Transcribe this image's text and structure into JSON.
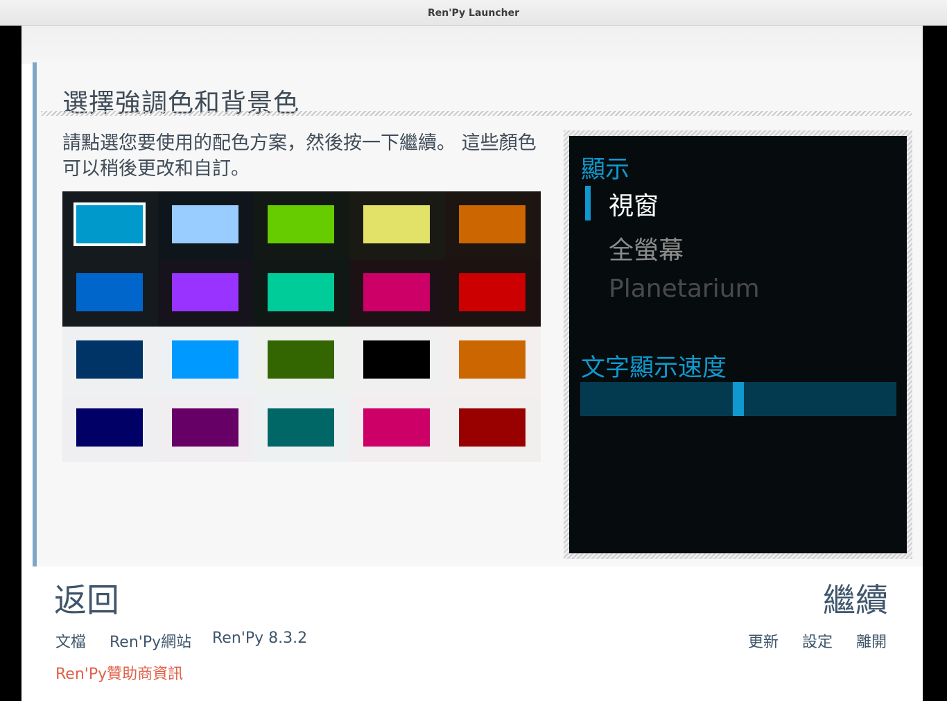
{
  "window": {
    "title": "Ren'Py Launcher"
  },
  "page": {
    "title": "選擇強調色和背景色",
    "instructions": "請點選您要使用的配色方案，然後按一下繼續。 這些顏色可以稍後更改和自訂。"
  },
  "swatches": {
    "selected_index": 0,
    "items": [
      {
        "color": "#0099cc",
        "cell_bg": "#141a1d"
      },
      {
        "color": "#99ccff",
        "cell_bg": "#0e161b"
      },
      {
        "color": "#66cc00",
        "cell_bg": "#121814"
      },
      {
        "color": "#e2e268",
        "cell_bg": "#1a1a15"
      },
      {
        "color": "#cc6600",
        "cell_bg": "#1c1512"
      },
      {
        "color": "#0066cc",
        "cell_bg": "#141a1d"
      },
      {
        "color": "#9933ff",
        "cell_bg": "#17131d"
      },
      {
        "color": "#00cc99",
        "cell_bg": "#101816"
      },
      {
        "color": "#cc0066",
        "cell_bg": "#1c1216"
      },
      {
        "color": "#cc0000",
        "cell_bg": "#1c1212"
      },
      {
        "color": "#003366",
        "cell_bg": "#eff0f2"
      },
      {
        "color": "#0099ff",
        "cell_bg": "#eef1f4"
      },
      {
        "color": "#336600",
        "cell_bg": "#eff1ee"
      },
      {
        "color": "#000000",
        "cell_bg": "#f0f0f0"
      },
      {
        "color": "#cc6600",
        "cell_bg": "#f2efee"
      },
      {
        "color": "#000066",
        "cell_bg": "#efeff2"
      },
      {
        "color": "#660066",
        "cell_bg": "#f1eef1"
      },
      {
        "color": "#006666",
        "cell_bg": "#eef1f1"
      },
      {
        "color": "#cc0066",
        "cell_bg": "#f2eef0"
      },
      {
        "color": "#990000",
        "cell_bg": "#f1eeee"
      }
    ]
  },
  "preview": {
    "display_heading": "顯示",
    "options": [
      {
        "label": "視窗",
        "selected": true
      },
      {
        "label": "全螢幕",
        "selected": false
      },
      {
        "label": "Planetarium",
        "selected": false
      }
    ],
    "text_speed_heading": "文字顯示速度",
    "text_speed_value": 0.5,
    "colors": {
      "accent": "#0f99cf",
      "selected": "#ffffff",
      "idle": "#8c8c8c",
      "disabled": "#4a4a4a"
    }
  },
  "nav": {
    "back": "返回",
    "continue": "繼續"
  },
  "footer": {
    "docs": "文檔",
    "website": "Ren'Py網站",
    "version": "Ren'Py 8.3.2",
    "update": "更新",
    "preferences": "設定",
    "quit": "離開",
    "sponsor": "Ren'Py贊助商資訊",
    "sponsor_color": "#e06048"
  }
}
